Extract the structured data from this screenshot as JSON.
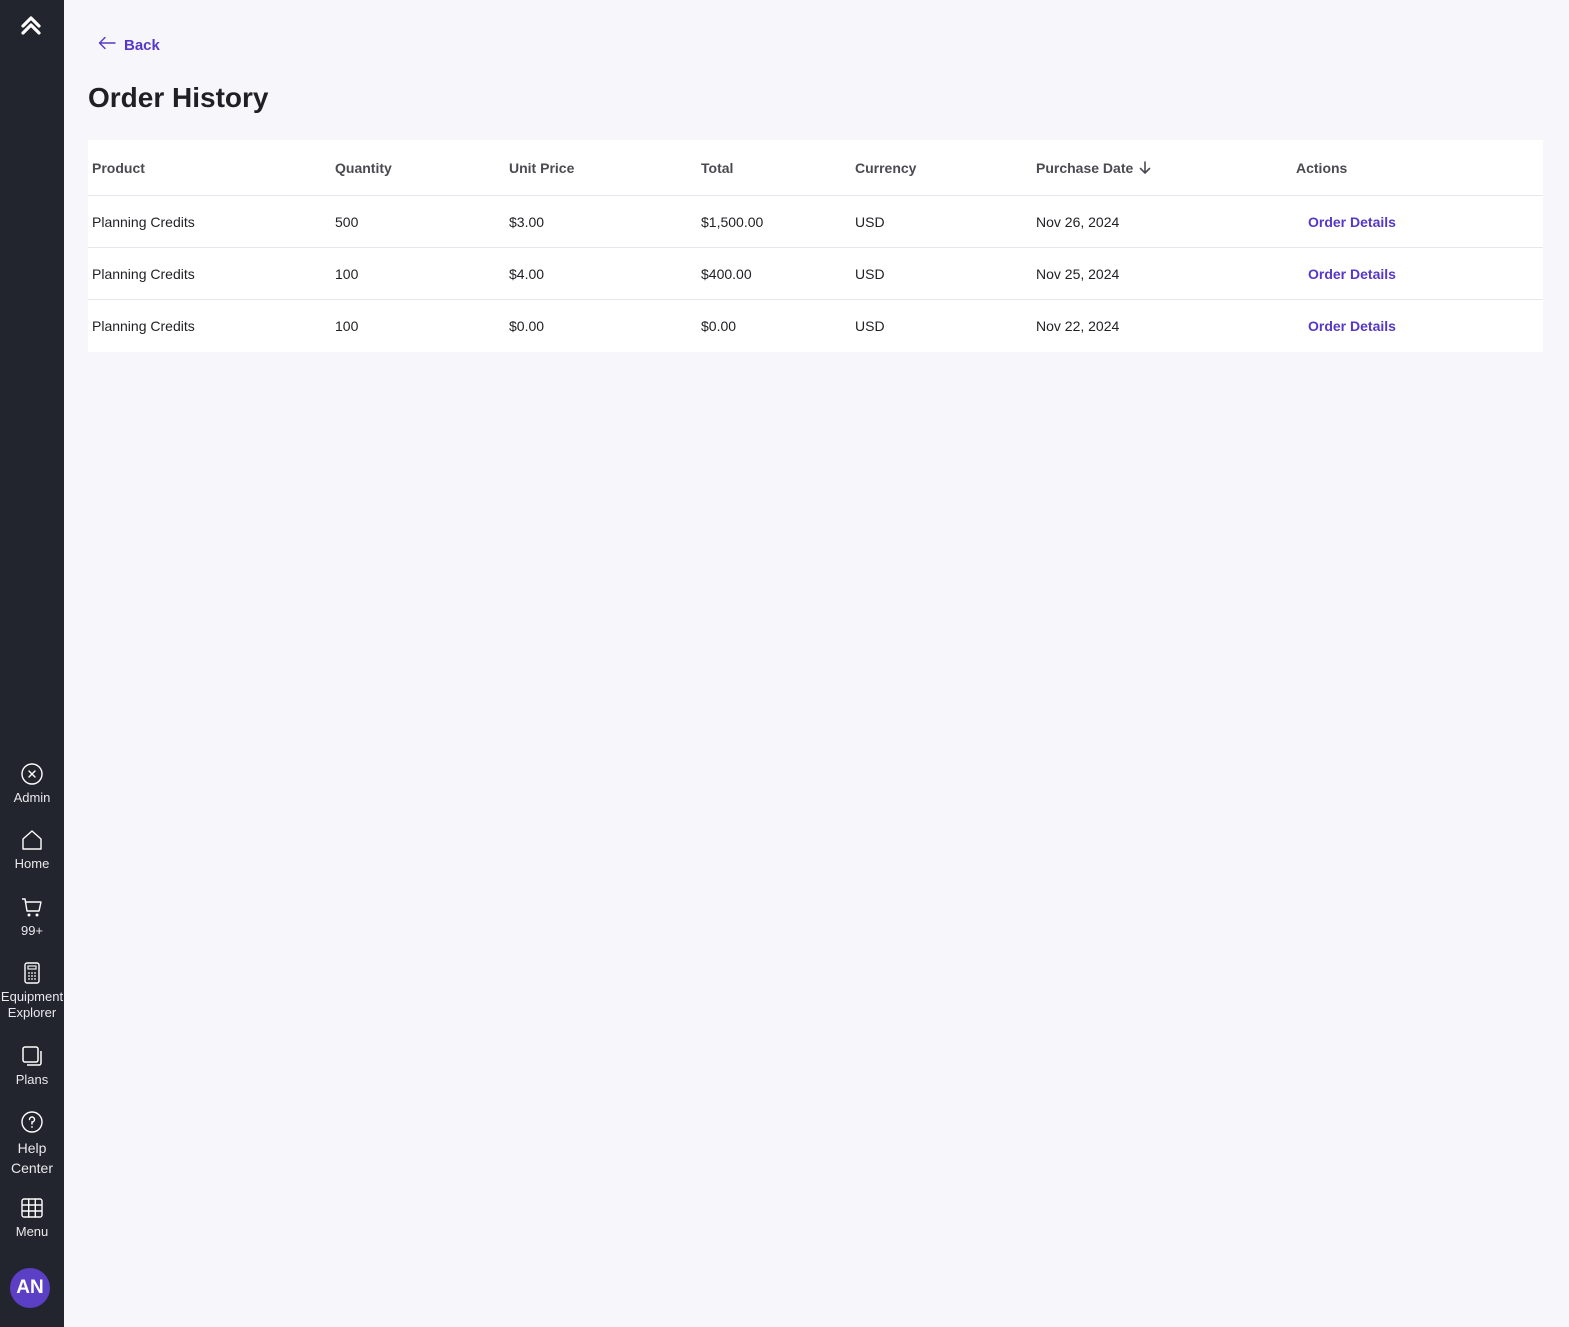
{
  "sidebar": {
    "items": [
      {
        "label": "Admin",
        "icon": "close-circle-icon"
      },
      {
        "label": "Home",
        "icon": "home-icon"
      },
      {
        "label": "99+",
        "icon": "cart-icon"
      },
      {
        "label": "Equipment Explorer",
        "icon": "calculator-icon"
      },
      {
        "label": "Plans",
        "icon": "copy-icon"
      },
      {
        "label": "Help Center",
        "icon": "help-icon"
      },
      {
        "label": "Menu",
        "icon": "grid-icon"
      }
    ],
    "avatar": "AN"
  },
  "header": {
    "back_label": "Back",
    "title": "Order History"
  },
  "table": {
    "columns": [
      "Product",
      "Quantity",
      "Unit Price",
      "Total",
      "Currency",
      "Purchase Date",
      "Actions"
    ],
    "rows": [
      {
        "product": "Planning Credits",
        "quantity": "500",
        "unit_price": "$3.00",
        "total": "$1,500.00",
        "currency": "USD",
        "date": "Nov 26, 2024",
        "action": "Order Details"
      },
      {
        "product": "Planning Credits",
        "quantity": "100",
        "unit_price": "$4.00",
        "total": "$400.00",
        "currency": "USD",
        "date": "Nov 25, 2024",
        "action": "Order Details"
      },
      {
        "product": "Planning Credits",
        "quantity": "100",
        "unit_price": "$0.00",
        "total": "$0.00",
        "currency": "USD",
        "date": "Nov 22, 2024",
        "action": "Order Details"
      }
    ]
  },
  "colors": {
    "sidebar_bg": "#22252d",
    "accent": "#5538c7",
    "avatar_bg": "#5b3fc4",
    "page_bg": "#f7f7fb"
  }
}
